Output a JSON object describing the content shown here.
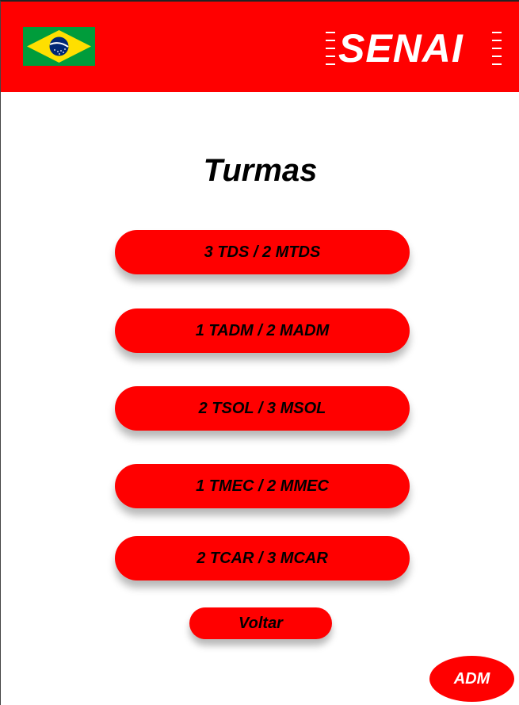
{
  "header": {
    "flag_icon": "brazil-flag-icon",
    "logo_text": "SENAI",
    "background_color": "#ff0000"
  },
  "main": {
    "title": "Turmas",
    "classes": [
      {
        "label": "3 TDS / 2 MTDS"
      },
      {
        "label": "1 TADM / 2 MADM"
      },
      {
        "label": "2 TSOL / 3 MSOL"
      },
      {
        "label": "1 TMEC / 2 MMEC"
      },
      {
        "label": "2 TCAR / 3 MCAR"
      }
    ],
    "back_label": "Voltar",
    "adm_label": "ADM"
  },
  "colors": {
    "accent": "#ff0000",
    "text": "#000000",
    "adm_text": "#ffffff"
  }
}
